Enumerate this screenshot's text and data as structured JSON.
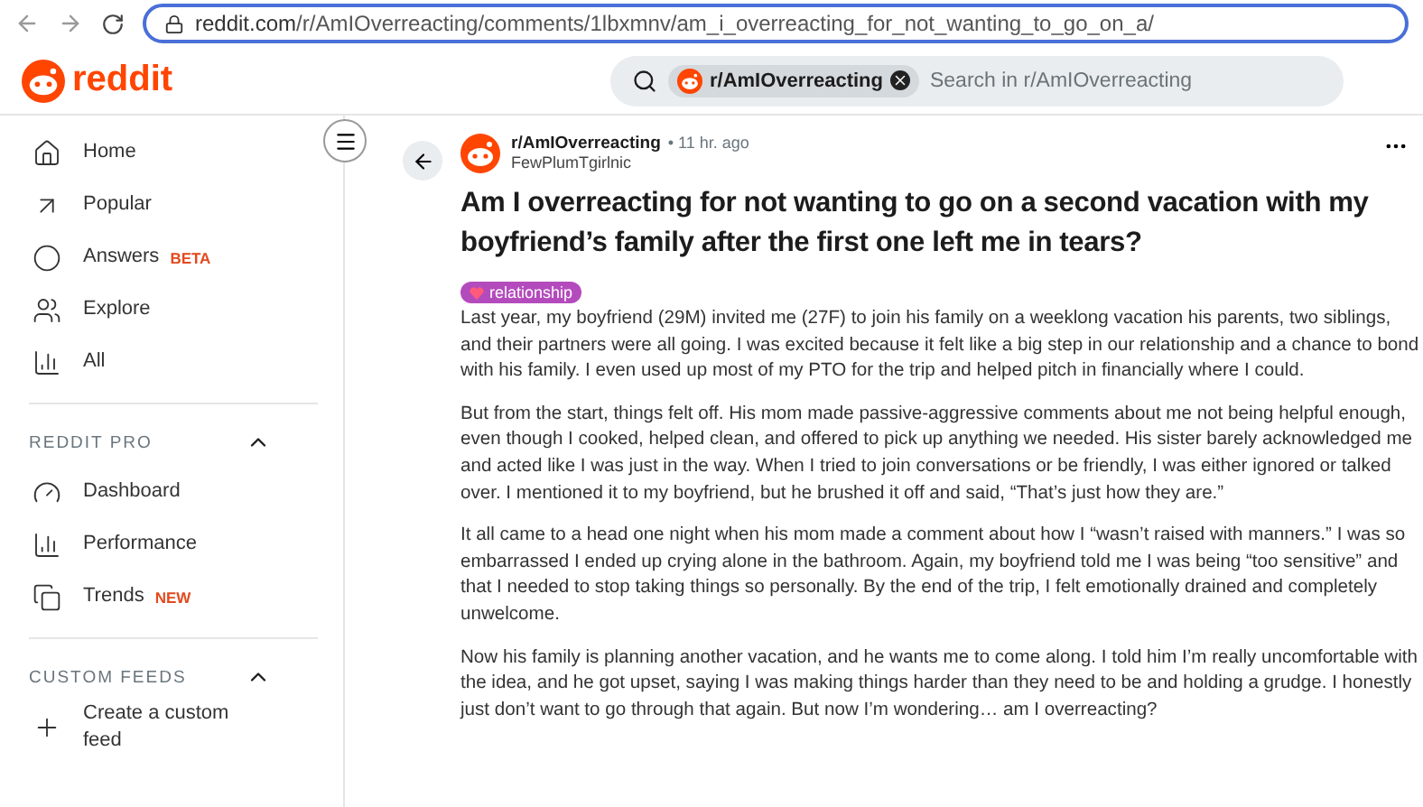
{
  "browser": {
    "url_host": "reddit.com",
    "url_path": "/r/AmIOverreacting/comments/1lbxmnv/am_i_overreacting_for_not_wanting_to_go_on_a/"
  },
  "header": {
    "logo": "reddit",
    "search": {
      "chip": "r/AmIOverreacting",
      "placeholder": "Search in r/AmIOverreacting"
    }
  },
  "sidebar": {
    "items": [
      {
        "label": "Home",
        "kind": "home"
      },
      {
        "label": "Popular",
        "kind": "popular"
      },
      {
        "label": "Answers",
        "kind": "answers",
        "badge": "BETA"
      },
      {
        "label": "Explore",
        "kind": "explore"
      },
      {
        "label": "All",
        "kind": "all"
      }
    ],
    "sections": [
      {
        "title": "REDDIT PRO",
        "expanded": true,
        "items": [
          {
            "label": "Dashboard",
            "kind": "dashboard"
          },
          {
            "label": "Performance",
            "kind": "performance"
          },
          {
            "label": "Trends",
            "kind": "trends",
            "badge": "NEW"
          }
        ]
      },
      {
        "title": "CUSTOM FEEDS",
        "expanded": true,
        "items": [
          {
            "label": "Create a custom feed",
            "kind": "plus"
          }
        ]
      }
    ]
  },
  "post": {
    "subreddit": "r/AmIOverreacting",
    "time": "• 11 hr. ago",
    "author": "FewPlumTgirlnic",
    "title": "Am I overreacting for not wanting to go on a second vacation with my boyfriend’s family after the first one left me in tears?",
    "flair": "relationship",
    "paragraphs": [
      "Last year, my boyfriend (29M) invited me (27F) to join his family on a weeklong vacation his parents, two siblings, and their partners were all going. I was excited because it felt like a big step in our relationship and a chance to bond with his family. I even used up most of my PTO for the trip and helped pitch in financially where I could.",
      "But from the start, things felt off. His mom made passive-aggressive comments about me not being helpful enough, even though I cooked, helped clean, and offered to pick up anything we needed. His sister barely acknowledged me and acted like I was just in the way. When I tried to join conversations or be friendly, I was either ignored or talked over. I mentioned it to my boyfriend, but he brushed it off and said, “That’s just how they are.”",
      "It all came to a head one night when his mom made a comment about how I “wasn’t raised with manners.” I was so embarrassed I ended up crying alone in the bathroom. Again, my boyfriend told me I was being “too sensitive” and that I needed to stop taking things so personally. By the end of the trip, I felt emotionally drained and completely unwelcome.",
      "Now his family is planning another vacation, and he wants me to come along. I told him I’m really uncomfortable with the idea, and he got upset, saying I was making things harder than they need to be and holding a grudge. I honestly just don’t want to go through that again. But now I’m wondering… am I overreacting?"
    ]
  }
}
